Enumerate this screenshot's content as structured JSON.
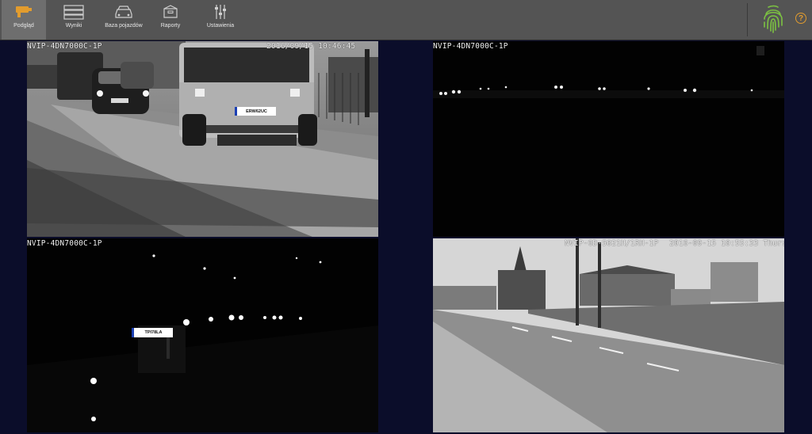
{
  "nav": {
    "items": [
      {
        "label": "Podgląd",
        "icon": "camera-icon",
        "active": true
      },
      {
        "label": "Wyniki",
        "icon": "results-list-icon",
        "active": false
      },
      {
        "label": "Baza pojazdów",
        "icon": "car-icon",
        "active": false
      },
      {
        "label": "Raporty",
        "icon": "report-box-icon",
        "active": false
      },
      {
        "label": "Ustawienia",
        "icon": "sliders-icon",
        "active": false
      }
    ]
  },
  "header": {
    "fingerprint_icon": "fingerprint-icon",
    "help_label": "?"
  },
  "colors": {
    "accent": "#e29c2e",
    "topbar": "#545454",
    "background": "#0b0d2a",
    "fingerprint": "#7cc242"
  },
  "feeds": [
    {
      "camera": "NVIP-4DN7000C-1P",
      "timestamp": "2016/09/15 10:46:45",
      "plate": "ERW62UC"
    },
    {
      "camera": "NVIP-4DN7000C-1P",
      "timestamp": ""
    },
    {
      "camera": "NVIP-4DN7000C-1P",
      "timestamp": "",
      "plate": "TPI78LA"
    },
    {
      "camera": "NVIP-6D-5021H/1RH-1P",
      "timestamp": "2016-09-15 10:55:33 Thurs"
    }
  ]
}
